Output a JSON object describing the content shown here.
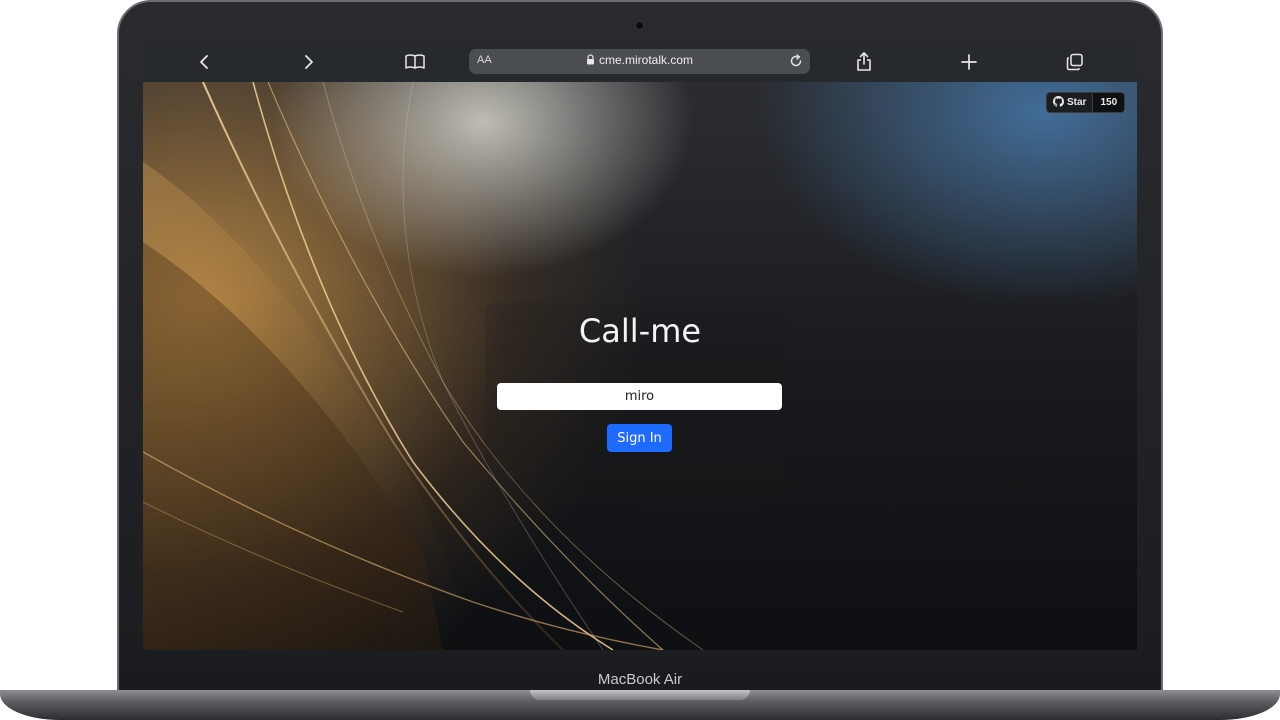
{
  "device": {
    "label": "MacBook Air"
  },
  "browser": {
    "address_aa": "AA",
    "url": "cme.mirotalk.com",
    "icons": [
      "back-icon",
      "forward-icon",
      "bookmarks-icon",
      "lock-icon",
      "reload-icon",
      "share-icon",
      "new-tab-icon",
      "tabs-icon"
    ]
  },
  "page": {
    "github": {
      "star_label": "Star",
      "count": "150",
      "icon": "github-icon"
    },
    "title": "Call-me",
    "username": {
      "value": "miro"
    },
    "sign_in_label": "Sign In",
    "colors": {
      "button": "#1f6bff",
      "toolbar": "#26292e"
    }
  }
}
